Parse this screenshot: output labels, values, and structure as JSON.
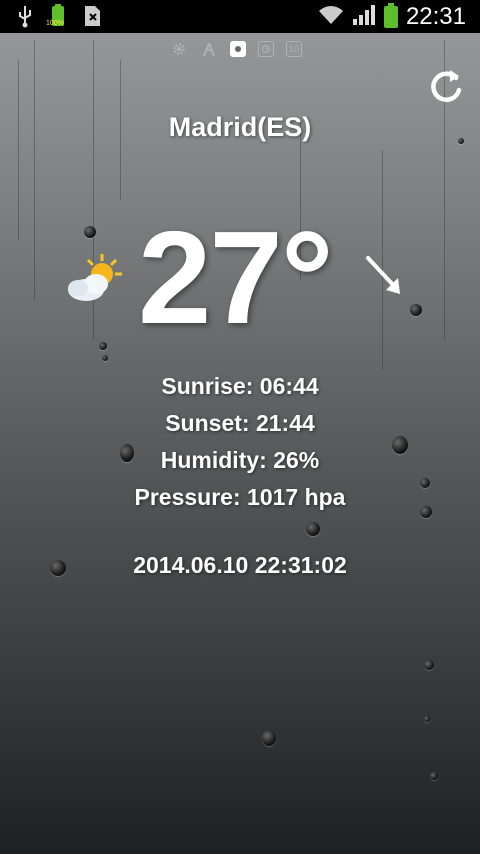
{
  "status_bar": {
    "time": "22:31",
    "battery_level_label": "100%"
  },
  "pages": {
    "items": [
      "gear-icon",
      "tower-icon",
      "weather-icon",
      "clock-icon",
      "ten-icon"
    ],
    "ten_label": "10",
    "active_index": 2
  },
  "weather": {
    "city": "Madrid(ES)",
    "temperature": "27°",
    "sunrise": "Sunrise: 06:44",
    "sunset": "Sunset: 21:44",
    "humidity": "Humidity: 26%",
    "pressure": "Pressure: 1017 hpa",
    "datetime": "2014.06.10 22:31:02",
    "condition_icon": "partly-cloudy-icon",
    "wind_icon": "wind-direction-arrow-icon"
  }
}
